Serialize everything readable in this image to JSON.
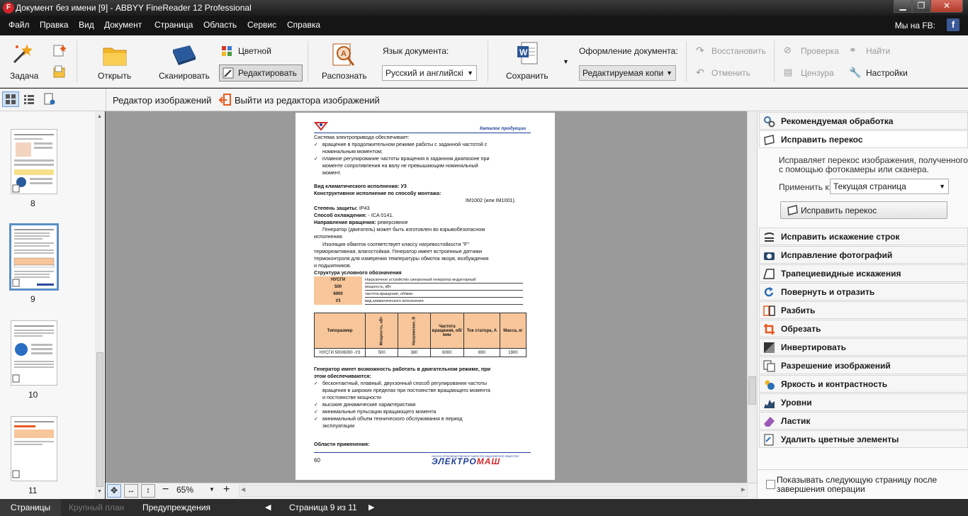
{
  "window": {
    "title": "Документ без имени [9] - ABBYY FineReader 12 Professional",
    "minimize_glyph": "▁",
    "restore_glyph": "❐",
    "close_glyph": "✕"
  },
  "menu": {
    "items": [
      "Файл",
      "Правка",
      "Вид",
      "Документ",
      "Страница",
      "Область",
      "Сервис",
      "Справка"
    ],
    "fb_label": "Мы на FB:",
    "fb_icon": "f"
  },
  "ribbon": {
    "task_label": "Задача",
    "open_label": "Открыть",
    "scan_label": "Сканировать",
    "color_label": "Цветной",
    "edit_label": "Редактировать",
    "recognize_label": "Распознать",
    "doc_language_label": "Язык документа:",
    "doc_language_value": "Русский и английскi",
    "save_label": "Сохранить",
    "doc_format_label": "Оформление документа:",
    "doc_format_value": "Редактируемая копи",
    "restore_label": "Восстановить",
    "undo_label": "Отменить",
    "check_label": "Проверка",
    "find_label": "Найти",
    "censor_label": "Цензура",
    "settings_label": "Настройки"
  },
  "toolbar2": {
    "editor_label": "Редактор изображений",
    "exit_label": "Выйти из редактора изображений"
  },
  "thumbnails": [
    {
      "num": "8"
    },
    {
      "num": "9"
    },
    {
      "num": "10"
    },
    {
      "num": "11"
    }
  ],
  "document": {
    "header_right": "Каталог продукции",
    "lines": [
      "Система электропривода обеспечивает:",
      "вращение в продолжительном режиме работы с заданной частотой с",
      "номинальным моментом;",
      "плавное регулирование частоты вращения в заданном диапазоне при",
      "моменте сопротивления на валу не превышающим номинальный",
      "момент."
    ],
    "climate": "Вид климатического исполнения: У3",
    "construct": "Конструктивное исполнение по способу  монтажа:",
    "construct_val": "IM1002 (или IM1001).",
    "protect_label": "Степень защиты:",
    "protect_val": " IP43",
    "cool_label": "Способ охлаждения:",
    "cool_val": "  - ICA 0141.",
    "dir_label": "Направление вращения:",
    "dir_val": "  реверсивное",
    "para1a": "Генератор (двигатель) может быть изготовлен во взрывобезопасном",
    "para1b": "исполнении.",
    "para2a": "Изоляция обмоток соответствует классу нагревостойкости \"F\"",
    "para2b": "термореактивная, влагостойкая.  Генератор имеет встроенные датчики",
    "para2c": "термоконтроля для измерения температуры обмоток якоря, возбуждения",
    "para2d": "и подшипников.",
    "struct_title": "Структура условного обозначения",
    "legend": [
      {
        "code": "НУСГИ",
        "desc": "Нагрузочное устройство синхронный генератор индукторный"
      },
      {
        "code": "500",
        "desc": "мощность, кВт"
      },
      {
        "code": "6000",
        "desc": "частота вращения, об/мин"
      },
      {
        "code": "У3",
        "desc": "вид климатического исполнения"
      }
    ],
    "table_headers": [
      "Типоразмер",
      "Мощность, кВт",
      "Напряжение, В",
      "Частота вращения, об/мин",
      "Ток статора, А",
      "Масса, кг"
    ],
    "table_row": [
      "НУСГИ 500/6000 -У3",
      "500",
      "380",
      "6000",
      "690",
      "1900"
    ],
    "gen_title1": "Генератор имеет возможность работать в двигательном режиме, при",
    "gen_title2": "этом обеспечиваются:",
    "gen_items": [
      "бесконтактный, плавный, двухзонный способ регулирования частоты",
      "вращения в широких пределах при постоянстве вращающего момента",
      "и постоянстве мощности",
      "высокие динамические характеристики",
      "минимальные пульсации вращающего момента",
      "минимальный объем технического обслуживания в период",
      "эксплуатации"
    ],
    "areas": "Области применения:",
    "page_num": "60",
    "brand_small": "НАУЧНО-ПРОИЗВОДСТВЕННОЕ ЗАКРЫТОЕ АКЦИОНЕРНОЕ ОБЩЕСТВО",
    "brand_a": "ЭЛЕКТРО",
    "brand_b": "МАШ"
  },
  "zoom": {
    "value": "65%"
  },
  "right_panel": {
    "recommended": "Рекомендуемая обработка",
    "deskew_title": "Исправить перекос",
    "deskew_desc1": "Исправляет перекос изображения, полученного",
    "deskew_desc2": "с помощью фотокамеры или сканера.",
    "apply_to_label": "Применить к:",
    "apply_to_value": "Текущая страница",
    "deskew_button": "Исправить перекос",
    "tools": [
      "Исправить искажение строк",
      "Исправление фотографий",
      "Трапециевидные искажения",
      "Повернуть и отразить",
      "Разбить",
      "Обрезать",
      "Инвертировать",
      "Разрешение изображений",
      "Яркость и контрастность",
      "Уровни",
      "Ластик",
      "Удалить цветные элементы"
    ],
    "show_next_1": "Показывать следующую страницу после",
    "show_next_2": "завершения операции"
  },
  "status": {
    "pages_tab": "Страницы",
    "closeup_tab": "Крупный план",
    "warnings_tab": "Предупреждения",
    "page_indicator": "Страница 9 из 11"
  },
  "colors": {
    "selection_blue": "#5b8ec6",
    "table_orange": "#f7c69a",
    "titlebar_dark": "#1c1c1c",
    "brand_blue": "#1f3f9a",
    "brand_red": "#d12a2a"
  }
}
